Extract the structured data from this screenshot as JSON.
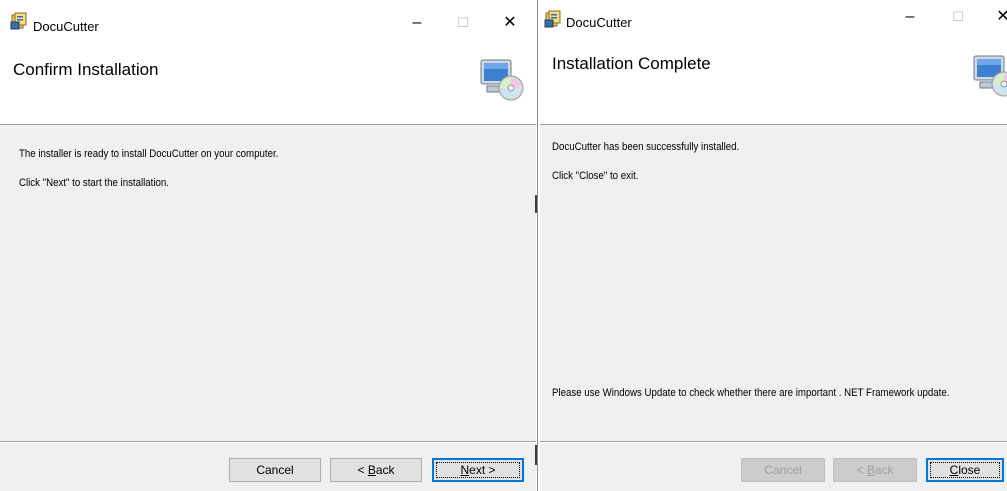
{
  "left_window": {
    "title": "DocuCutter",
    "controls": {
      "minimize": "–",
      "maximize": "☐",
      "close": "✕"
    },
    "heading": "Confirm Installation",
    "lines": [
      "The installer is ready to install DocuCutter on your computer.",
      "Click \"Next\" to start the installation."
    ],
    "buttons": {
      "cancel": "Cancel",
      "back_prefix": "< ",
      "back_accel": "B",
      "back_rest": "ack",
      "next_accel": "N",
      "next_rest": "ext >"
    },
    "icon": "computer-disc-icon"
  },
  "right_window": {
    "title": "DocuCutter",
    "controls": {
      "minimize": "–",
      "maximize": "☐",
      "close": "✕"
    },
    "heading": "Installation Complete",
    "lines": [
      "DocuCutter has been successfully installed.",
      "Click \"Close\" to exit."
    ],
    "footer_note": "Please use Windows Update to check whether there are important . NET Framework update.",
    "buttons": {
      "cancel": "Cancel",
      "back_prefix": "< ",
      "back_accel": "B",
      "back_rest": "ack",
      "close_accel": "C",
      "close_rest": "lose"
    },
    "icon": "computer-disc-icon"
  }
}
